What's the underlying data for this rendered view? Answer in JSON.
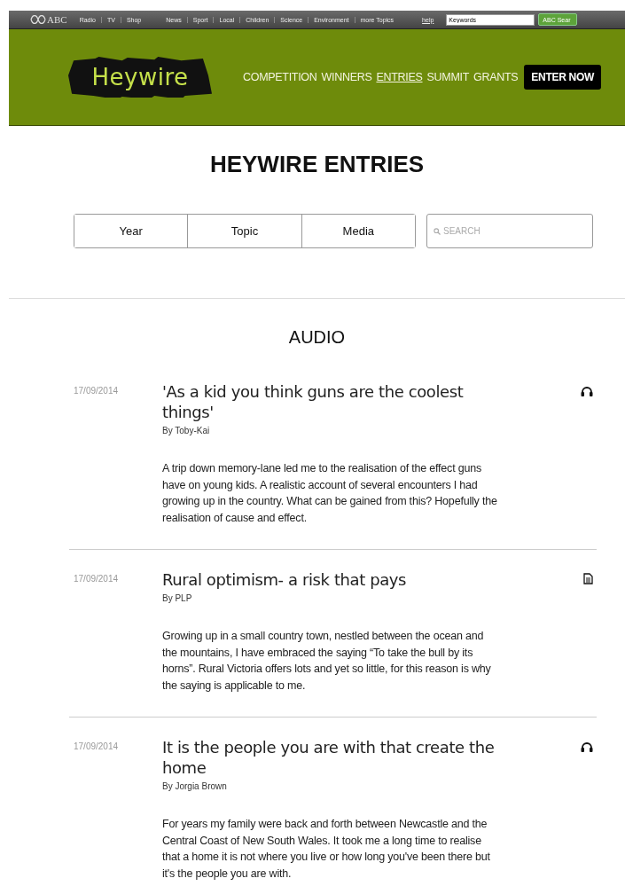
{
  "abc_bar": {
    "logo": "ABC",
    "links": [
      "Radio",
      "TV",
      "Shop"
    ],
    "topics": [
      "News",
      "Sport",
      "Local",
      "Children",
      "Science",
      "Environment",
      "more Topics"
    ],
    "help": "help",
    "search": {
      "value": "Keywords"
    },
    "search_button": "ABC Sear"
  },
  "header": {
    "logo": "Heywire",
    "nav": [
      {
        "label": "COMPETITION",
        "selected": false
      },
      {
        "label": "WINNERS",
        "selected": false
      },
      {
        "label": "ENTRIES",
        "selected": true
      },
      {
        "label": "SUMMIT",
        "selected": false
      },
      {
        "label": "GRANTS",
        "selected": false
      }
    ],
    "cta": "ENTER NOW"
  },
  "page_title": "HEYWIRE ENTRIES",
  "filters": [
    "Year",
    "Topic",
    "Media"
  ],
  "search": {
    "placeholder": "SEARCH"
  },
  "section_title": "AUDIO",
  "entries": [
    {
      "date": "17/09/2014",
      "title": "'As a kid you think guns are the coolest things'",
      "author": "By Toby-Kai",
      "kind": "audio",
      "summary": "A trip down memory-lane led me to the realisation of the effect guns have on young kids. A realistic account of several encounters I had growing up in the country. What can be gained from this? Hopefully the realisation of cause and effect."
    },
    {
      "date": "17/09/2014",
      "title": "Rural optimism- a risk that pays",
      "author": "By PLP",
      "kind": "text",
      "summary": "Growing up in a small country town, nestled between the ocean and the mountains, I have embraced the saying “To take the bull by its horns”. Rural Victoria offers lots and yet so little, for this reason is why the saying is applicable to me."
    },
    {
      "date": "17/09/2014",
      "title": "It is the people you are with that create the home",
      "author": "By Jorgia Brown",
      "kind": "audio",
      "summary": "For years my family were back and forth between Newcastle and the Central Coast of New South Wales. It took me a long time to realise that a home it is not where you live or how long you've been there but it's the people you are with."
    }
  ]
}
